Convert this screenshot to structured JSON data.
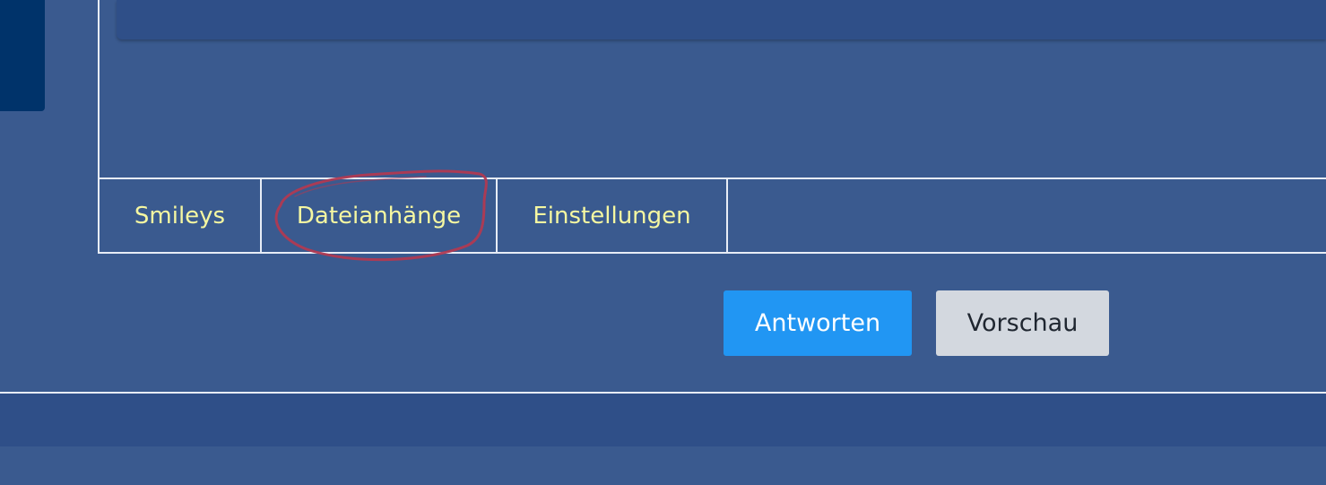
{
  "tabs": [
    {
      "label": "Smileys"
    },
    {
      "label": "Dateianhänge"
    },
    {
      "label": "Einstellungen"
    }
  ],
  "actions": {
    "reply_label": "Antworten",
    "preview_label": "Vorschau"
  },
  "colors": {
    "page_background": "#3a5a8f",
    "dark_sidebar": "#00336a",
    "tab_text": "#f5f7a1",
    "reply_button": "#2196f3",
    "preview_button": "#d3d8df",
    "highlight_ring": "#b03a52"
  }
}
